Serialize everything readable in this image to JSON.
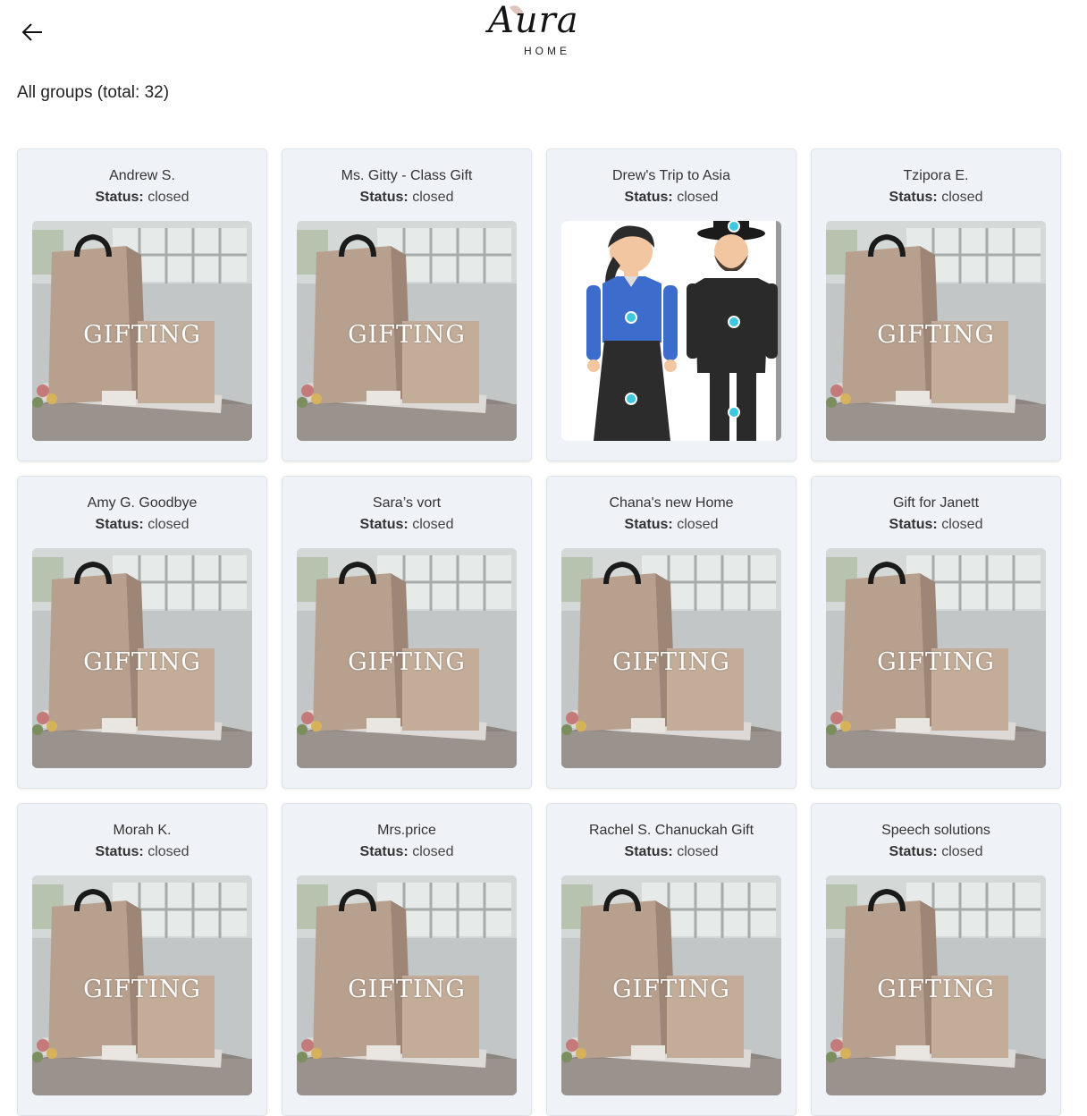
{
  "header": {
    "back_icon": "arrow-left-icon",
    "logo_script": "Aura",
    "logo_sub": "HOME"
  },
  "page": {
    "title": "All groups (total: 32)"
  },
  "status_label": "Status:",
  "thumbnail_text": "GIFTING",
  "groups": [
    {
      "name": "Andrew S.",
      "status": "closed",
      "image": "gifting-bag"
    },
    {
      "name": "Ms. Gitty - Class Gift",
      "status": "closed",
      "image": "gifting-bag"
    },
    {
      "name": "Drew's Trip to Asia",
      "status": "closed",
      "image": "couple-illustration"
    },
    {
      "name": "Tzipora E.",
      "status": "closed",
      "image": "gifting-bag"
    },
    {
      "name": "Amy G. Goodbye",
      "status": "closed",
      "image": "gifting-bag"
    },
    {
      "name": "Sara’s vort",
      "status": "closed",
      "image": "gifting-bag"
    },
    {
      "name": "Chana's new Home",
      "status": "closed",
      "image": "gifting-bag"
    },
    {
      "name": "Gift for Janett",
      "status": "closed",
      "image": "gifting-bag"
    },
    {
      "name": "Morah K.",
      "status": "closed",
      "image": "gifting-bag"
    },
    {
      "name": "Mrs.price",
      "status": "closed",
      "image": "gifting-bag"
    },
    {
      "name": "Rachel S. Chanuckah Gift",
      "status": "closed",
      "image": "gifting-bag"
    },
    {
      "name": "Speech solutions",
      "status": "closed",
      "image": "gifting-bag"
    }
  ]
}
